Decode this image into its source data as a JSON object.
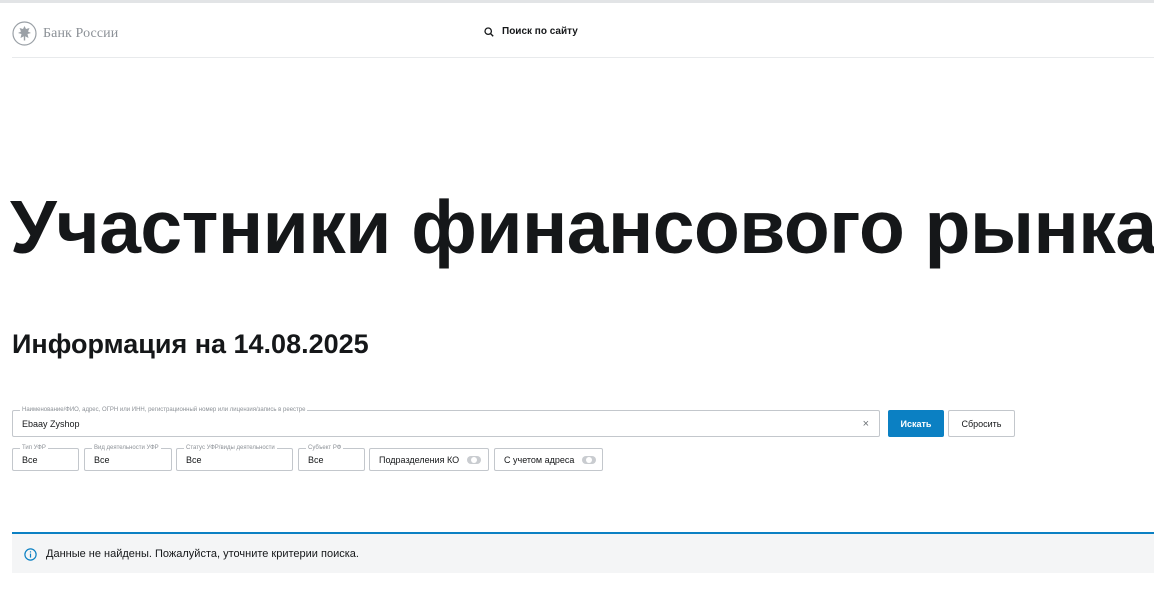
{
  "header": {
    "logo_text": "Банк России",
    "search_label": "Поиск по сайту"
  },
  "page": {
    "title": "Участники финансового рынка",
    "info_date": "Информация на 14.08.2025"
  },
  "search_form": {
    "query_legend": "Наименование/ФИО, адрес, ОГРН или ИНН, регистрационный номер или лицензия/запись в реестре",
    "query_value": "Ebaay Zyshop",
    "clear_symbol": "×",
    "submit_label": "Искать",
    "reset_label": "Сбросить",
    "filters": [
      {
        "legend": "Тип УФР",
        "value": "Все"
      },
      {
        "legend": "Вид деятельности УФР",
        "value": "Все"
      },
      {
        "legend": "Статус УФР/виды деятельности",
        "value": "Все"
      },
      {
        "legend": "Субъект РФ",
        "value": "Все"
      }
    ],
    "toggles": [
      {
        "label": "Подразделения КО",
        "state": "off"
      },
      {
        "label": "С учетом адреса",
        "state": "off"
      }
    ]
  },
  "notice": {
    "text": "Данные не найдены. Пожалуйста, уточните критерии поиска."
  },
  "colors": {
    "accent": "#0b80c3",
    "text": "#151719",
    "muted": "#8c9197",
    "border": "#c3c7cc",
    "notice_bg": "#f4f5f6"
  },
  "icons": {
    "logo": "bank-emblem-icon",
    "search": "search-icon",
    "clear": "close-icon",
    "notice": "info-icon"
  }
}
